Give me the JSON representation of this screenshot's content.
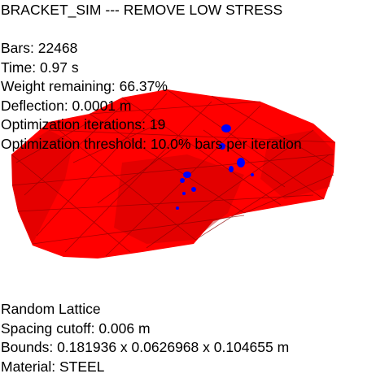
{
  "title": "BRACKET_SIM --- REMOVE LOW STRESS",
  "stats": {
    "bars": "Bars: 22468",
    "time": "Time: 0.97 s",
    "weight_remaining": "Weight remaining: 66.37%",
    "deflection": "Deflection: 0.0001 m",
    "iterations": "Optimization iterations: 19",
    "threshold": "Optimization threshold: 10.0% bars per iteration"
  },
  "lattice_info": {
    "type": "Random Lattice",
    "spacing": "Spacing cutoff: 0.006 m",
    "bounds": "Bounds: 0.181936 x 0.0626968 x 0.104655 m",
    "material": "Material: STEEL"
  },
  "colors": {
    "bar_normal": "#ff0000",
    "bar_dark": "#b00000",
    "bar_highlight": "#0000ff",
    "background": "#ffffff",
    "text": "#000000"
  }
}
